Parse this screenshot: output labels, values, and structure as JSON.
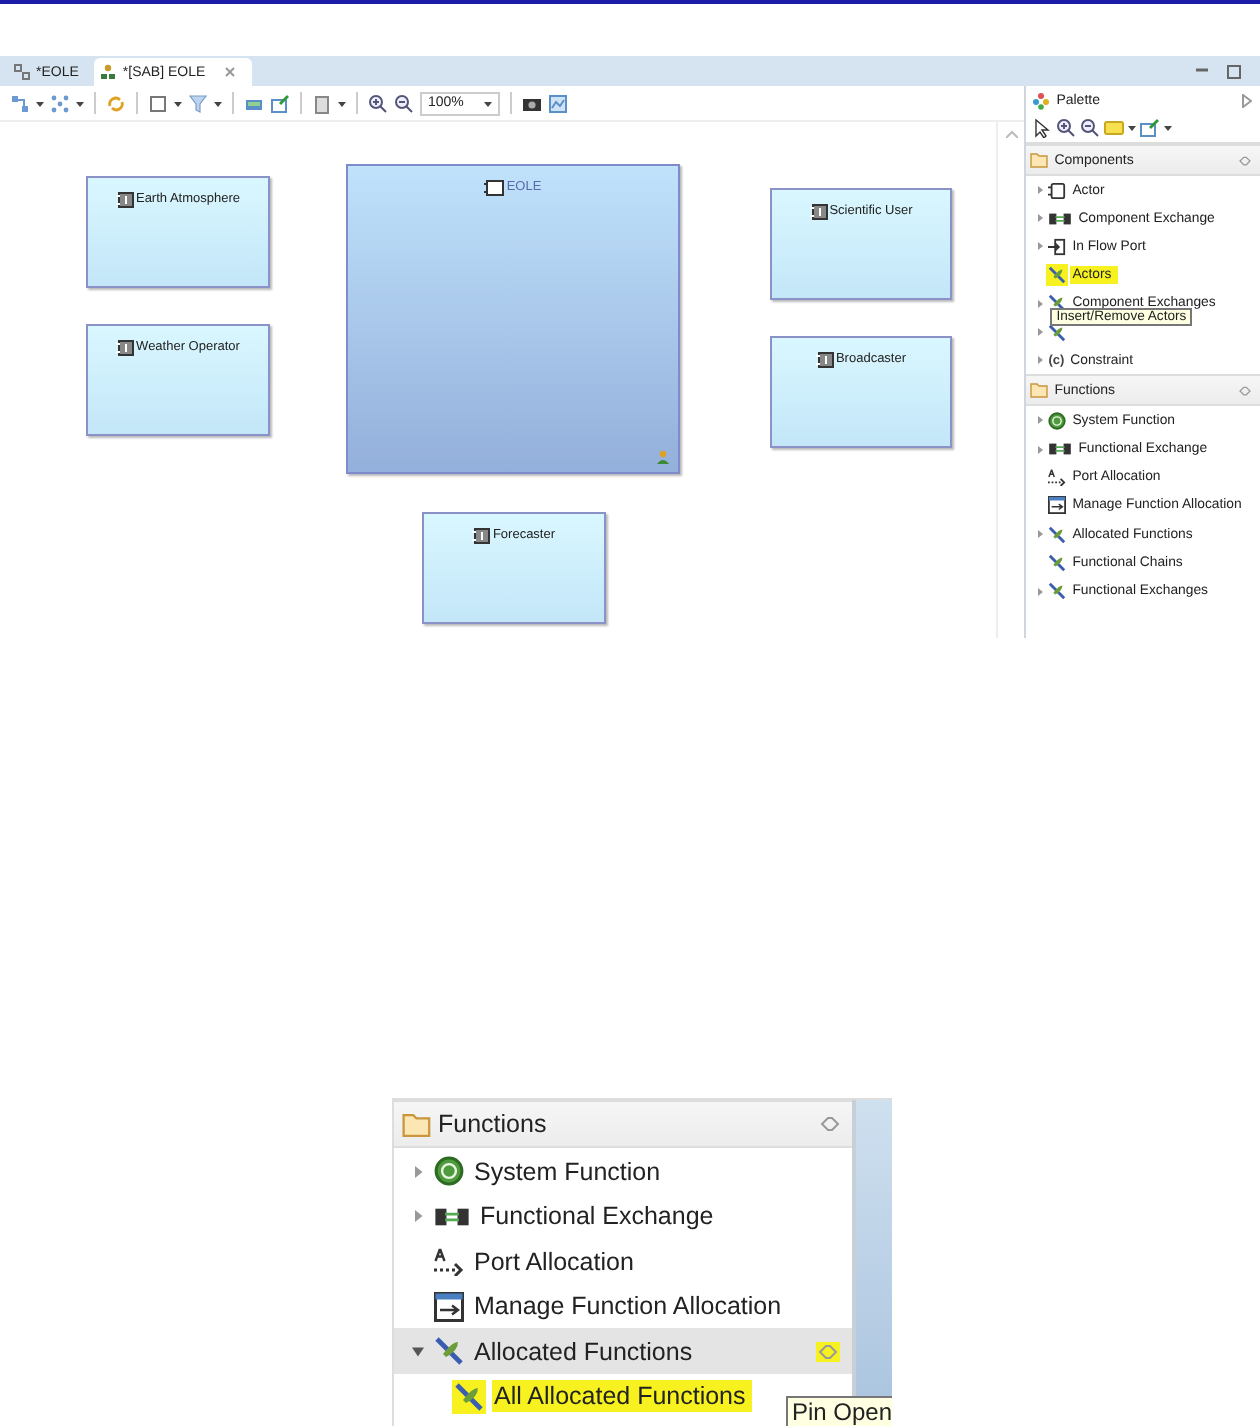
{
  "editor": {
    "tabs": [
      {
        "label": "*EOLE",
        "kind": "diagram",
        "selected": false
      },
      {
        "label": "*[SAB] EOLE",
        "kind": "architecture",
        "selected": true,
        "closable": true
      }
    ],
    "zoom": "100%",
    "nodes": [
      {
        "label": "Earth Atmosphere",
        "kind": "actor"
      },
      {
        "label": "Weather Operator",
        "kind": "actor"
      },
      {
        "label": "EOLE",
        "kind": "system"
      },
      {
        "label": "Scientific User",
        "kind": "actor"
      },
      {
        "label": "Broadcaster",
        "kind": "actor"
      },
      {
        "label": "Forecaster",
        "kind": "actor"
      }
    ]
  },
  "palette": {
    "title": "Palette",
    "drawers": [
      {
        "label": "Components",
        "items": [
          {
            "label": "Actor",
            "kind": "actor",
            "expandable": true,
            "highlighted": false
          },
          {
            "label": "Component Exchange",
            "kind": "exchange",
            "expandable": true,
            "highlighted": false
          },
          {
            "label": "In Flow Port",
            "kind": "port",
            "expandable": true,
            "highlighted": false
          },
          {
            "label": "Actors",
            "kind": "filter",
            "highlighted": true,
            "tooltip": "Insert/Remove Actors"
          },
          {
            "label": "Component Exchanges",
            "kind": "filter",
            "expandable": true,
            "highlighted": false
          },
          {
            "kind": "filter",
            "expandable": true,
            "highlighted": false
          },
          {
            "label": "Constraint",
            "kind": "text",
            "icon_text": "(c)",
            "expandable": true,
            "highlighted": false
          }
        ]
      },
      {
        "label": "Functions",
        "items": [
          {
            "label": "System Function",
            "kind": "function",
            "expandable": true,
            "highlighted": false
          },
          {
            "label": "Functional Exchange",
            "kind": "exchange",
            "expandable": true,
            "highlighted": false
          },
          {
            "label": "Port Allocation",
            "kind": "allocation",
            "highlighted": false
          },
          {
            "label": "Manage Function Allocation",
            "kind": "manage",
            "highlighted": false
          },
          {
            "label": "Allocated Functions",
            "kind": "filter",
            "expandable": true,
            "highlighted": false
          },
          {
            "label": "Functional Chains",
            "kind": "filter",
            "highlighted": false
          },
          {
            "label": "Functional Exchanges",
            "kind": "filter",
            "expandable": true,
            "highlighted": false
          }
        ]
      }
    ]
  },
  "detail": {
    "drawer": {
      "label": "Functions",
      "items": [
        {
          "label": "System Function",
          "kind": "function",
          "expandable": true,
          "highlighted": false
        },
        {
          "label": "Functional Exchange",
          "kind": "exchange",
          "expandable": true,
          "highlighted": false
        },
        {
          "label": "Port Allocation",
          "kind": "allocation",
          "highlighted": false
        },
        {
          "label": "Manage Function Allocation",
          "kind": "manage",
          "highlighted": false
        },
        {
          "label": "Allocated Functions",
          "kind": "filter",
          "expandable": true,
          "expanded": true,
          "highlighted": false,
          "hovered": true,
          "pin": {
            "highlighted": true,
            "tooltip": "Pin Open"
          },
          "children": [
            {
              "label": "All Allocated Functions",
              "kind": "filter",
              "highlighted": true
            }
          ]
        }
      ]
    }
  }
}
